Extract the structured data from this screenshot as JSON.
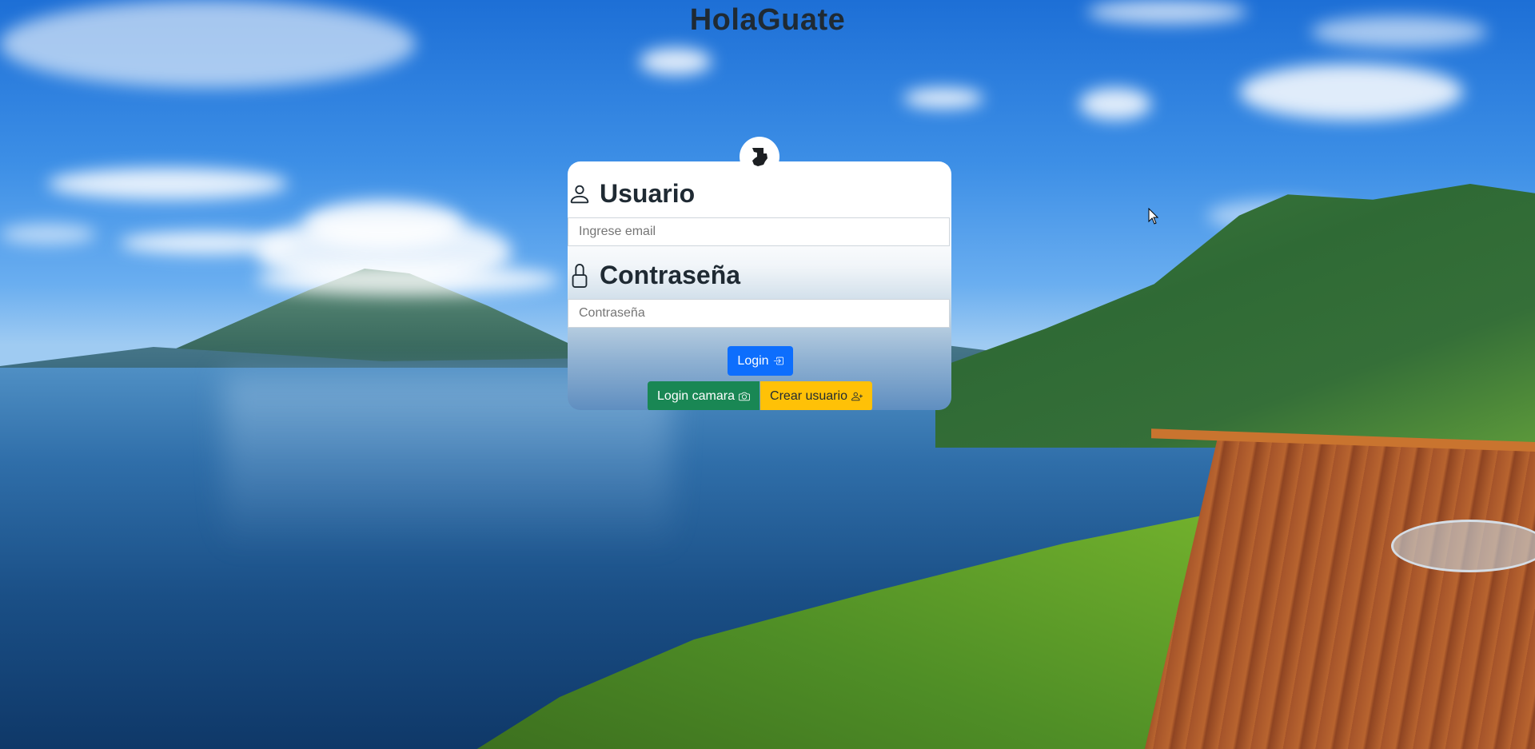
{
  "app": {
    "title": "HolaGuate"
  },
  "login_form": {
    "user_label": "Usuario",
    "user_placeholder": "Ingrese email",
    "password_label": "Contraseña",
    "password_placeholder": "Contraseña",
    "login_button": "Login",
    "camera_button": "Login camara",
    "create_button": "Crear usuario"
  },
  "icons": {
    "avatar": "guatemala-map-icon",
    "user": "person-icon",
    "password": "lock-icon",
    "login": "box-arrow-in-right-icon",
    "camera": "camera-icon",
    "create": "person-plus-icon"
  },
  "colors": {
    "primary": "#0d6efd",
    "success": "#198754",
    "warning": "#ffc107",
    "title": "#1f2a33"
  }
}
